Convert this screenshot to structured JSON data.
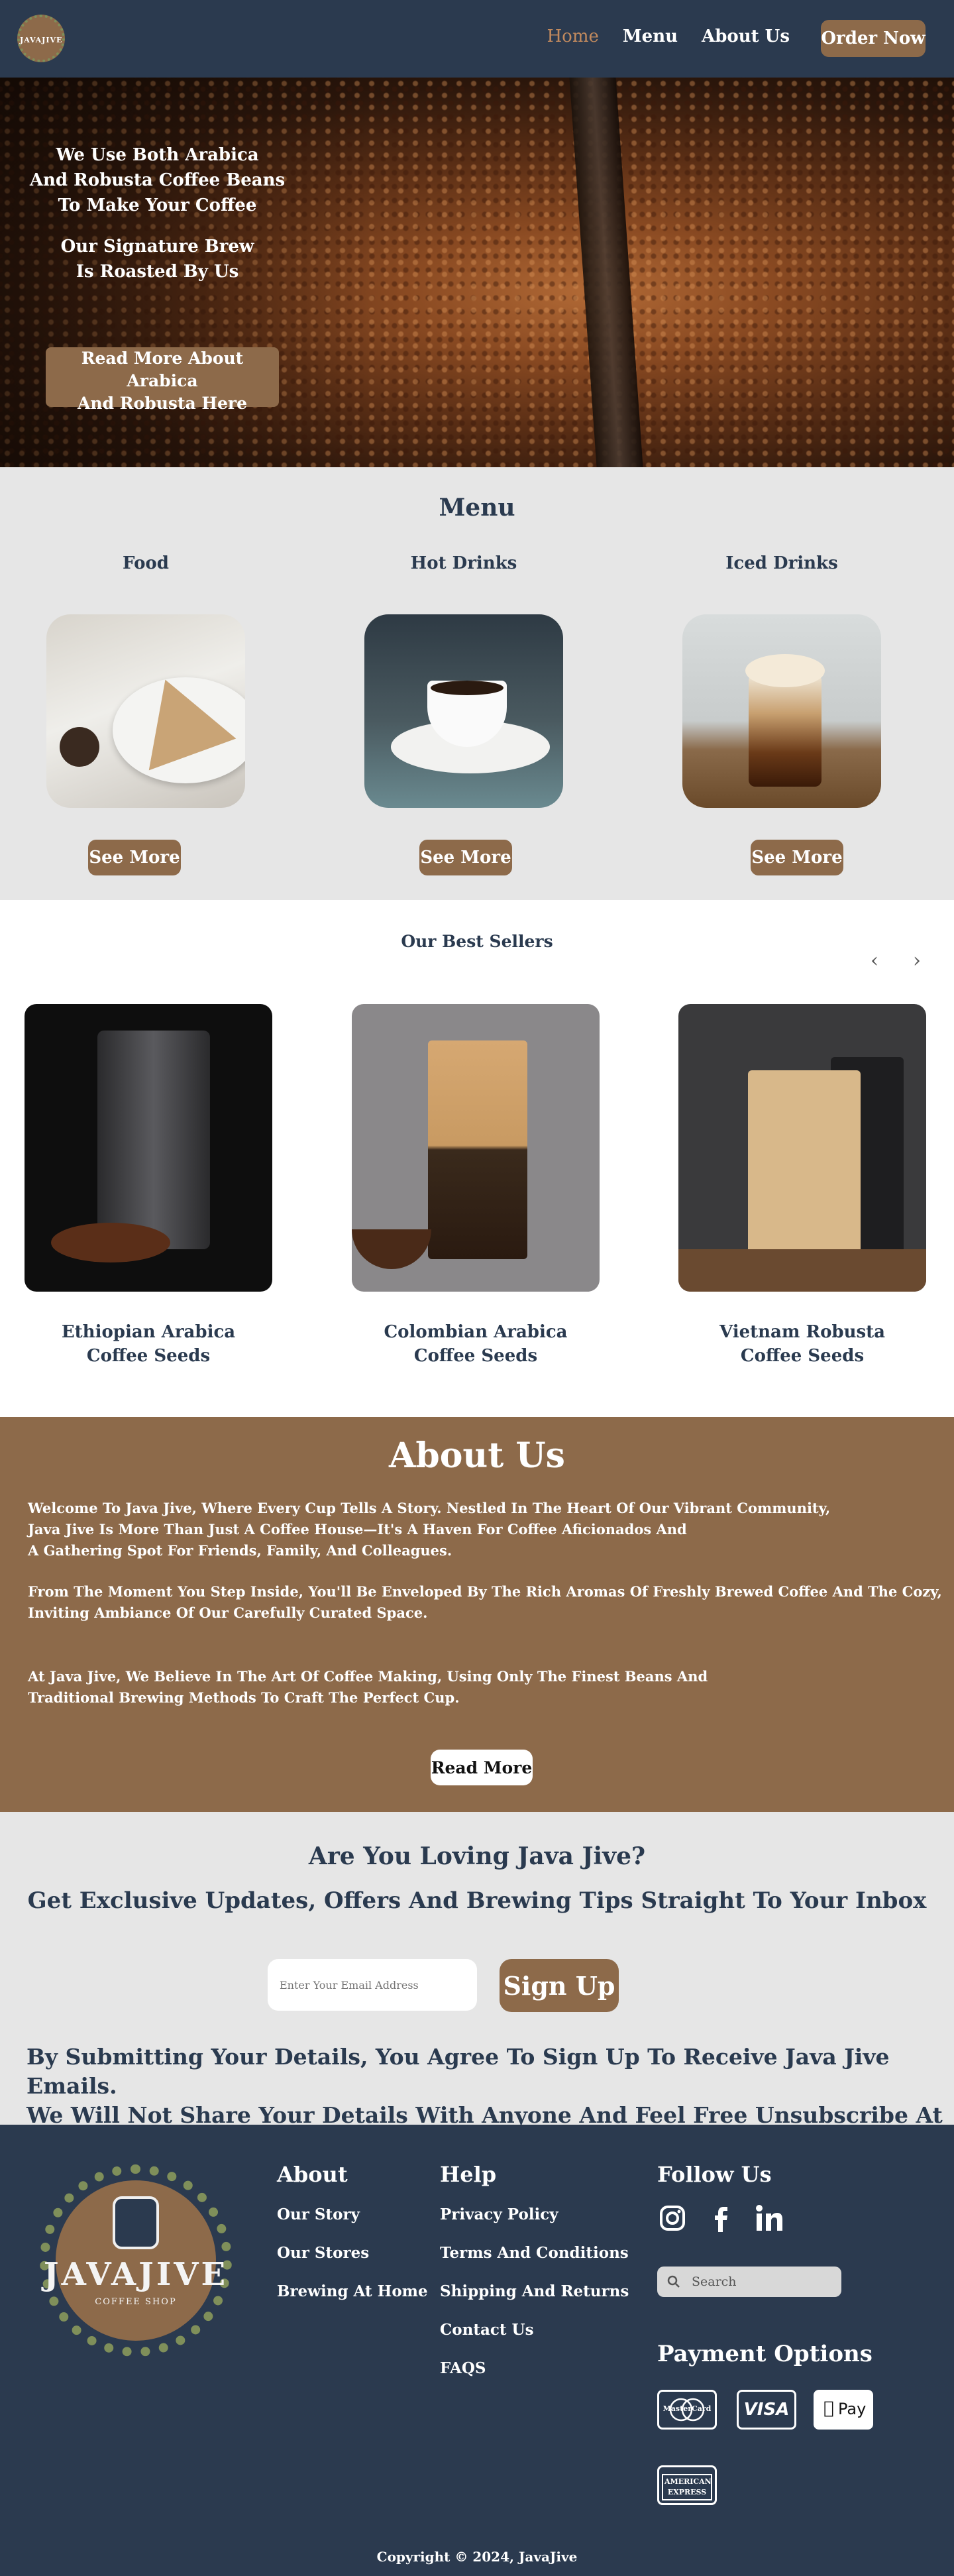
{
  "nav": {
    "logo_text": "JAVAJIVE",
    "links": [
      "Home",
      "Menu",
      "About Us"
    ],
    "order_label": "Order Now"
  },
  "hero": {
    "text1": "We Use Both Arabica\nAnd Robusta Coffee Beans\nTo Make Your Coffee",
    "text2": "Our Signature Brew\nIs Roasted By Us",
    "cta": "Read More About Arabica\nAnd Robusta Here"
  },
  "menu": {
    "title": "Menu",
    "categories": [
      "Food",
      "Hot Drinks",
      "Iced Drinks"
    ],
    "see_more": "See More"
  },
  "best": {
    "title": "Our Best Sellers",
    "prev": "‹",
    "next": "›",
    "products": [
      "Ethiopian Arabica\nCoffee Seeds",
      "Colombian Arabica\nCoffee Seeds",
      "Vietnam Robusta\nCoffee Seeds"
    ]
  },
  "about": {
    "title": "About Us",
    "p1": "Welcome To Java Jive, Where Every Cup Tells A Story.  Nestled In The Heart Of Our Vibrant Community,\nJava Jive Is More Than Just A Coffee House—It's A Haven For Coffee Aficionados And\nA Gathering Spot For Friends, Family, And Colleagues.",
    "p2": "From The Moment You Step Inside, You'll Be Enveloped By The Rich Aromas Of Freshly Brewed Coffee And The Cozy,\nInviting Ambiance Of Our Carefully Curated Space.",
    "p3": "At Java Jive, We Believe In The Art Of Coffee Making, Using Only The Finest Beans And\n Traditional Brewing Methods To Craft The Perfect Cup.",
    "read_more": "Read More"
  },
  "newsletter": {
    "question": "Are You Loving Java Jive?",
    "subtitle": "Get Exclusive Updates, Offers And Brewing Tips Straight To Your Inbox",
    "placeholder": "Enter Your Email Address",
    "signup": "Sign Up",
    "disclaimer": "By Submitting Your Details, You Agree To Sign Up To Receive Java Jive Emails.\nWe Will Not Share Your Details With Anyone And Feel Free Unsubscribe At Any Time."
  },
  "footer": {
    "brand": "JAVAJIVE",
    "brand_sub": "COFFEE SHOP",
    "about_title": "About",
    "about_links": [
      "Our Story",
      "Our Stores",
      "Brewing At Home"
    ],
    "help_title": "Help",
    "help_links": [
      "Privacy Policy",
      "Terms And Conditions",
      "Shipping And Returns",
      "Contact Us",
      "FAQS"
    ],
    "follow_title": "Follow Us",
    "social_icons": [
      "instagram-icon",
      "facebook-icon",
      "linkedin-icon"
    ],
    "search_placeholder": "Search",
    "payment_title": "Payment Options",
    "payment_cards": [
      "MasterCard",
      "VISA",
      "Pay",
      "AMERICAN EXPRESS"
    ],
    "copyright": "Copyright © 2024, JavaJive"
  },
  "colors": {
    "navy": "#2b3a4f",
    "brown": "#8d6a4a",
    "light_gray": "#e6e6e6",
    "accent_link": "#c28a5e"
  }
}
